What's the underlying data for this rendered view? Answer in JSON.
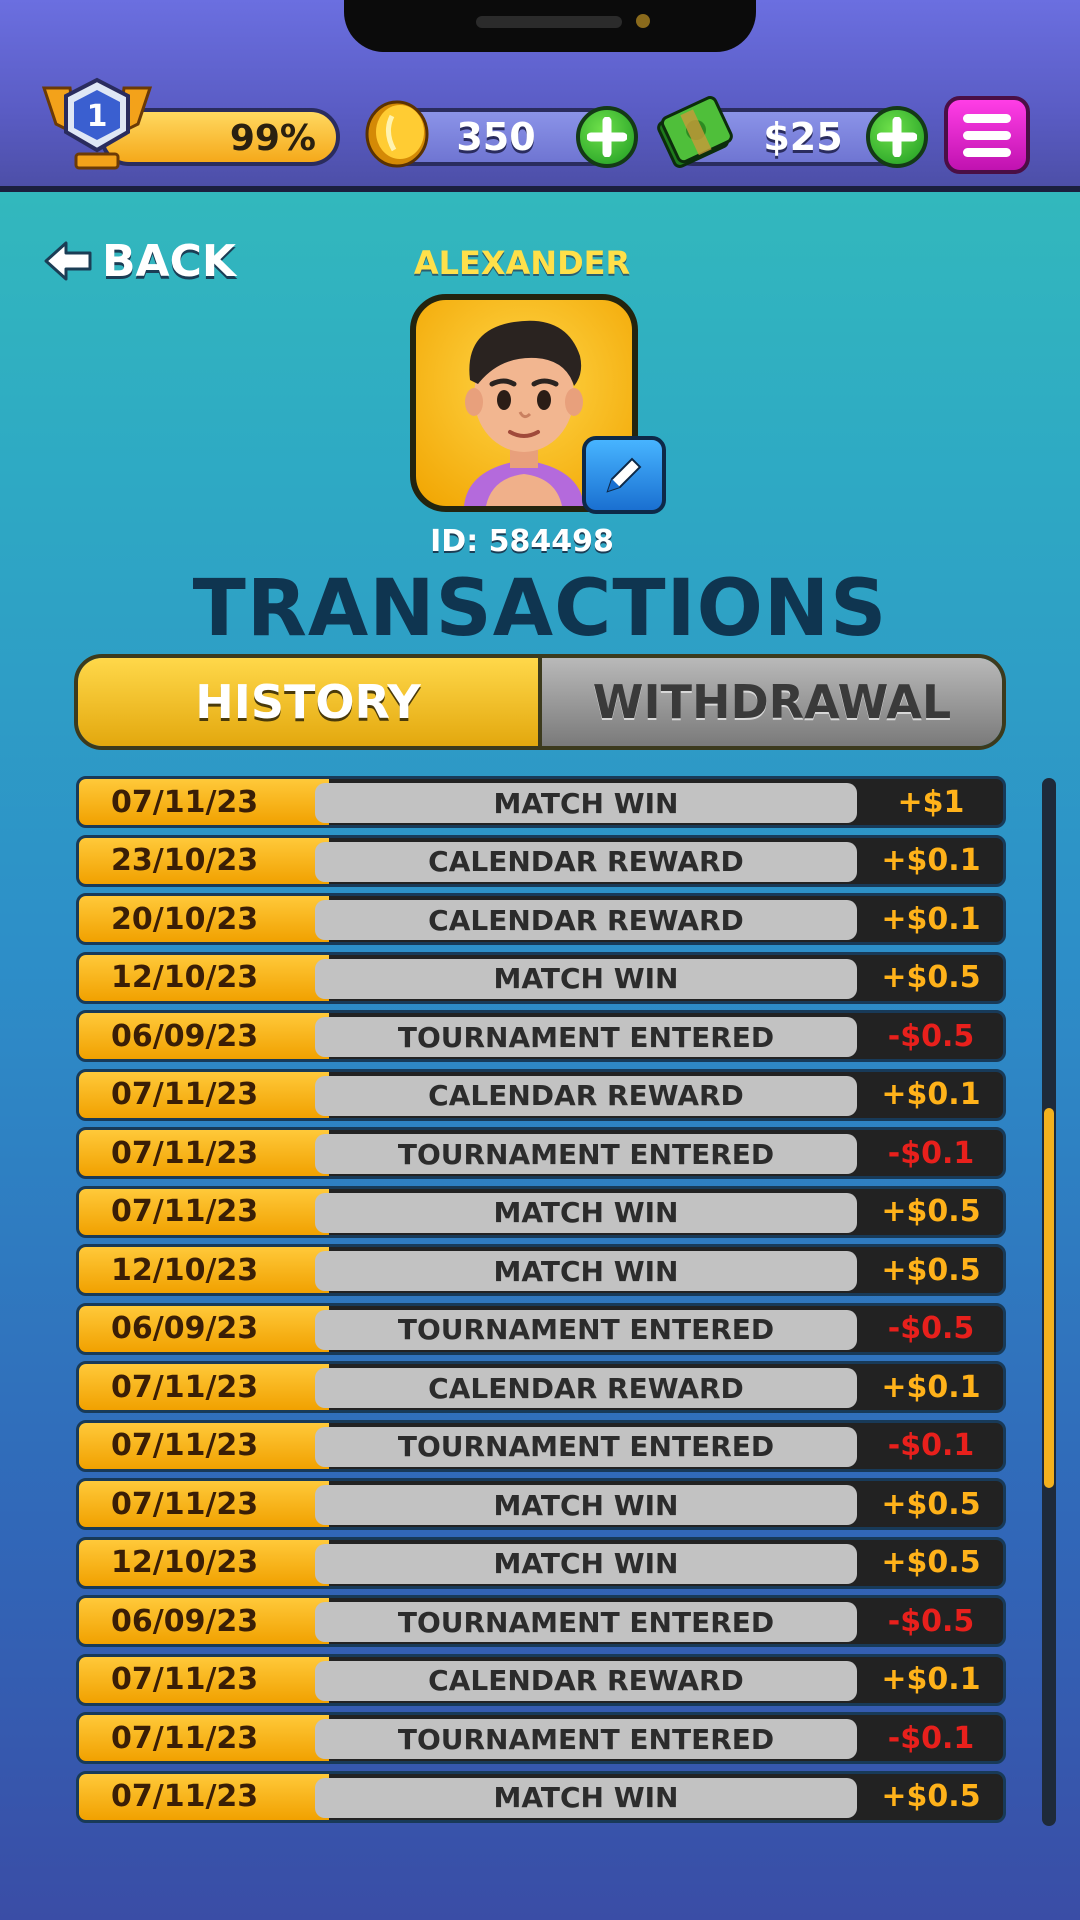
{
  "hud": {
    "level": "1",
    "progress": "99%",
    "coins": "350",
    "cash": "$25",
    "colors": {
      "topbar": "#6b6fe0",
      "plus": "#1d9a22",
      "menu": "#c012b0"
    }
  },
  "profile": {
    "back_label": "BACK",
    "name": "ALEXANDER",
    "id_label": "ID: 584498"
  },
  "page": {
    "title": "TRANSACTIONS"
  },
  "tabs": [
    {
      "label": "HISTORY",
      "active": true
    },
    {
      "label": "WITHDRAWAL",
      "active": false
    }
  ],
  "transactions": [
    {
      "date": "07/11/23",
      "desc": "MATCH WIN",
      "amount": "+$1",
      "positive": true
    },
    {
      "date": "23/10/23",
      "desc": "CALENDAR REWARD",
      "amount": "+$0.1",
      "positive": true
    },
    {
      "date": "20/10/23",
      "desc": "CALENDAR REWARD",
      "amount": "+$0.1",
      "positive": true
    },
    {
      "date": "12/10/23",
      "desc": "MATCH WIN",
      "amount": "+$0.5",
      "positive": true
    },
    {
      "date": "06/09/23",
      "desc": "TOURNAMENT ENTERED",
      "amount": "-$0.5",
      "positive": false
    },
    {
      "date": "07/11/23",
      "desc": "CALENDAR REWARD",
      "amount": "+$0.1",
      "positive": true
    },
    {
      "date": "07/11/23",
      "desc": "TOURNAMENT ENTERED",
      "amount": "-$0.1",
      "positive": false
    },
    {
      "date": "07/11/23",
      "desc": "MATCH WIN",
      "amount": "+$0.5",
      "positive": true
    },
    {
      "date": "12/10/23",
      "desc": "MATCH WIN",
      "amount": "+$0.5",
      "positive": true
    },
    {
      "date": "06/09/23",
      "desc": "TOURNAMENT ENTERED",
      "amount": "-$0.5",
      "positive": false
    },
    {
      "date": "07/11/23",
      "desc": "CALENDAR REWARD",
      "amount": "+$0.1",
      "positive": true
    },
    {
      "date": "07/11/23",
      "desc": "TOURNAMENT ENTERED",
      "amount": "-$0.1",
      "positive": false
    },
    {
      "date": "07/11/23",
      "desc": "MATCH WIN",
      "amount": "+$0.5",
      "positive": true
    },
    {
      "date": "12/10/23",
      "desc": "MATCH WIN",
      "amount": "+$0.5",
      "positive": true
    },
    {
      "date": "06/09/23",
      "desc": "TOURNAMENT ENTERED",
      "amount": "-$0.5",
      "positive": false
    },
    {
      "date": "07/11/23",
      "desc": "CALENDAR REWARD",
      "amount": "+$0.1",
      "positive": true
    },
    {
      "date": "07/11/23",
      "desc": "TOURNAMENT ENTERED",
      "amount": "-$0.1",
      "positive": false
    },
    {
      "date": "07/11/23",
      "desc": "MATCH WIN",
      "amount": "+$0.5",
      "positive": true
    }
  ]
}
